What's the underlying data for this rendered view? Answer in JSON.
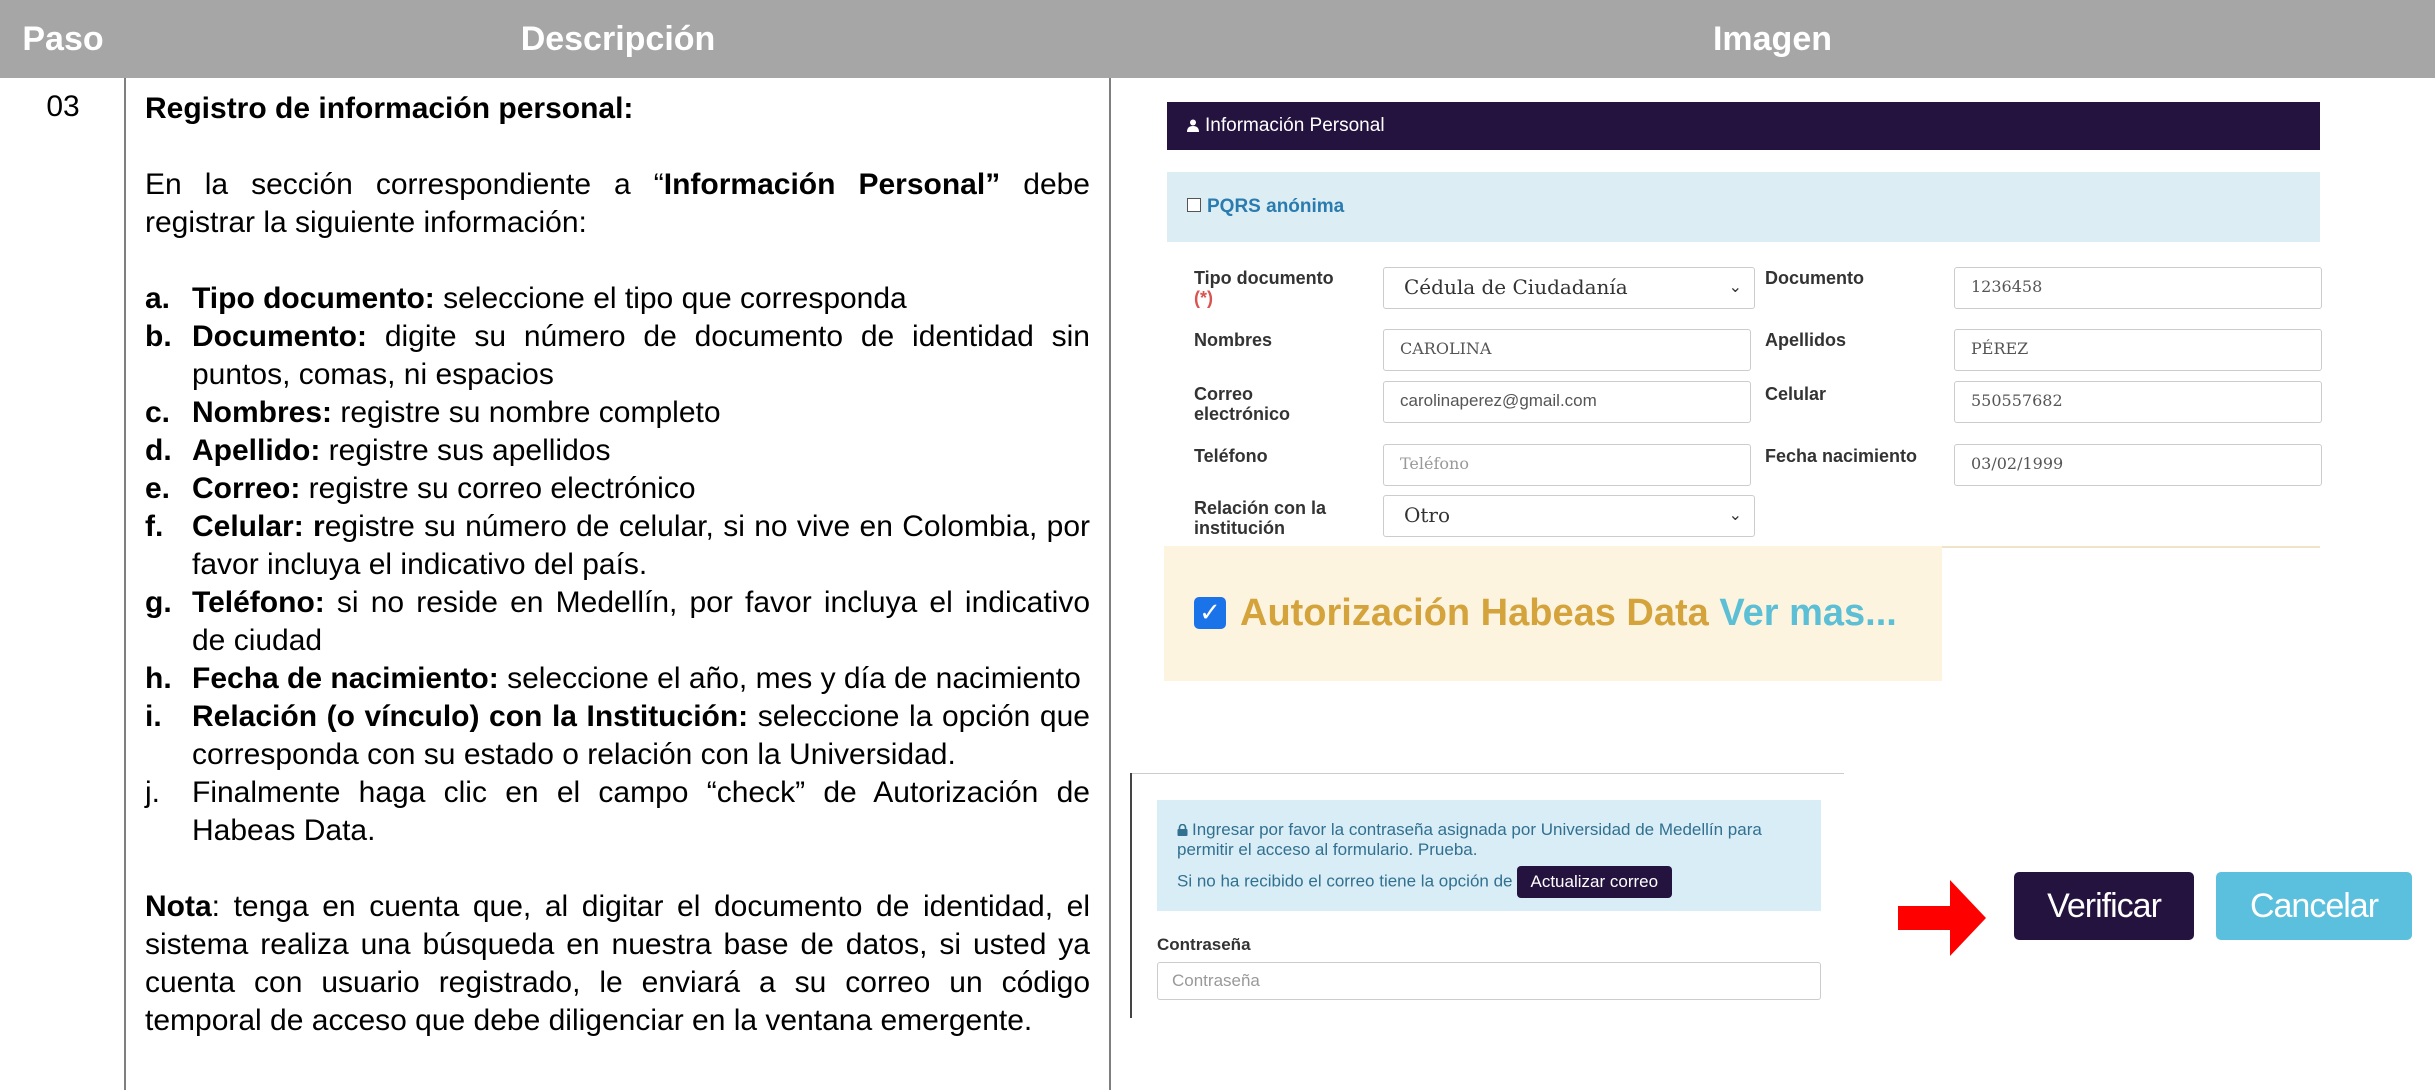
{
  "header": {
    "col_step": "Paso",
    "col_description": "Descripción",
    "col_image": "Imagen"
  },
  "row": {
    "step": "03",
    "title": "Registro de información personal:",
    "intro_pre": "En la sección correspondiente a “",
    "intro_bold": "Información Personal”",
    "intro_post": " debe registrar la siguiente información:",
    "items": [
      {
        "letter": "a.",
        "term": "Tipo documento:",
        "text": " seleccione el tipo que corresponda"
      },
      {
        "letter": "b.",
        "term": "Documento:",
        "text": " digite su número de documento de identidad sin puntos, comas, ni espacios"
      },
      {
        "letter": "c.",
        "term": "Nombres:",
        "text": " registre su nombre completo"
      },
      {
        "letter": "d.",
        "term": "Apellido:",
        "text": " registre sus apellidos"
      },
      {
        "letter": "e.",
        "term": "Correo:",
        "text": " registre su correo electrónico"
      },
      {
        "letter": "f.",
        "term": "Celular: r",
        "text": "egistre su número de celular, si no vive en Colombia, por favor incluya el indicativo del país."
      },
      {
        "letter": "g.",
        "term": "Teléfono:",
        "text": " si no reside en Medellín, por favor incluya el indicativo de ciudad"
      },
      {
        "letter": "h.",
        "term": "Fecha de nacimiento:",
        "text": " seleccione el año, mes y día de nacimiento"
      },
      {
        "letter": "i.",
        "term": "Relación (o vínculo) con la Institución:",
        "text": " seleccione la opción que corresponda con su estado o relación con la Universidad."
      },
      {
        "letter": "j.",
        "term": "",
        "text": "Finalmente haga clic en el campo “check” de Autorización de Habeas Data."
      }
    ],
    "note_label": "Nota",
    "note_text": ": tenga en cuenta que, al digitar el documento de identidad, el sistema realiza una búsqueda en nuestra base de datos, si usted ya cuenta con usuario registrado, le enviará a su correo un código temporal de acceso que debe diligenciar en la ventana emergente."
  },
  "form": {
    "section_title": "Información Personal",
    "pqrs_label": "PQRS anónima",
    "tipo_label": "Tipo documento",
    "required_mark": "(*)",
    "tipo_value": "Cédula de Ciudadanía",
    "documento_label": "Documento",
    "documento_value": "1236458",
    "nombres_label": "Nombres",
    "nombres_value": "CAROLINA",
    "apellidos_label": "Apellidos",
    "apellidos_value": "PÉREZ",
    "correo_label_1": "Correo",
    "correo_label_2": "electrónico",
    "correo_value": "carolinaperez@gmail.com",
    "celular_label": "Celular",
    "celular_value": "550557682",
    "telefono_label": "Teléfono",
    "telefono_placeholder": "Teléfono",
    "fecha_label": "Fecha nacimiento",
    "fecha_value": "03/02/1999",
    "relacion_label_1": "Relación con la",
    "relacion_label_2": "institución",
    "relacion_value": "Otro",
    "habeas_label": "Autorización Habeas Data",
    "habeas_link": "Ver mas...",
    "habeas_checked": true
  },
  "password": {
    "info_line1": "Ingresar por favor la contraseña asignada por Universidad de Medellín para",
    "info_line2": "permitir el acceso al formulario. Prueba.",
    "info_line3": "Si no ha recibido el correo tiene la opción de",
    "update_button": "Actualizar correo",
    "label": "Contraseña",
    "placeholder": "Contraseña"
  },
  "actions": {
    "verify": "Verificar",
    "cancel": "Cancelar"
  },
  "colors": {
    "header_bg": "#a6a6a6",
    "brand_dark": "#24123f",
    "info_bg": "#d9edf7",
    "cancel_bg": "#5bc0de",
    "arrow": "#ff0000",
    "habeas_text": "#d4a33b"
  }
}
